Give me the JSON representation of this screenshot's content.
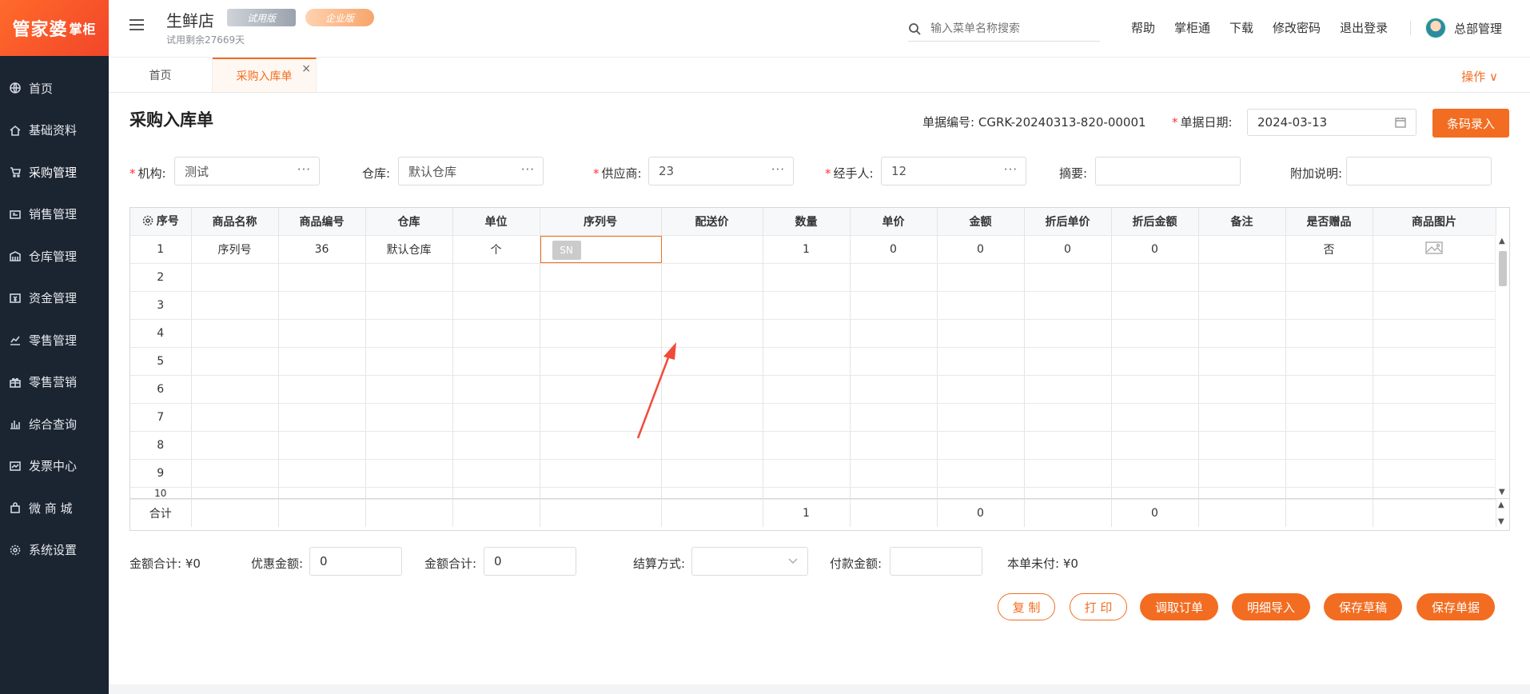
{
  "brand": {
    "logo_text": "管家婆",
    "logo_suffix": "掌柜"
  },
  "sidebar": {
    "items": [
      {
        "label": "首页",
        "icon": "globe-icon"
      },
      {
        "label": "基础资料",
        "icon": "home-icon"
      },
      {
        "label": "采购管理",
        "icon": "cart-icon"
      },
      {
        "label": "销售管理",
        "icon": "sales-icon"
      },
      {
        "label": "仓库管理",
        "icon": "warehouse-icon"
      },
      {
        "label": "资金管理",
        "icon": "money-icon"
      },
      {
        "label": "零售管理",
        "icon": "chart-icon"
      },
      {
        "label": "零售营销",
        "icon": "gift-icon"
      },
      {
        "label": "综合查询",
        "icon": "bar-chart-icon"
      },
      {
        "label": "发票中心",
        "icon": "invoice-icon"
      },
      {
        "label": "微 商 城",
        "icon": "bag-icon"
      },
      {
        "label": "系统设置",
        "icon": "gear-icon"
      }
    ]
  },
  "header": {
    "shop": "生鲜店",
    "trial_badge": "试用版",
    "enterprise_badge": "企业版",
    "trial_days": "试用剩余27669天",
    "search_placeholder": "输入菜单名称搜索",
    "links": [
      "帮助",
      "掌柜通",
      "下载",
      "修改密码",
      "退出登录"
    ],
    "user": "总部管理"
  },
  "tabs": {
    "home": "首页",
    "purchase": "采购入库单",
    "ops": "操作 ∨",
    "close": "×"
  },
  "form": {
    "title": "采购入库单",
    "doc_no_label": "单据编号:",
    "doc_no": "CGRK-20240313-820-00001",
    "date_label": "单据日期:",
    "date": "2024-03-13",
    "barcode_btn": "条码录入",
    "org_label": "机构:",
    "org": "测试",
    "warehouse_label": "仓库:",
    "warehouse": "默认仓库",
    "supplier_label": "供应商:",
    "supplier": "23",
    "handler_label": "经手人:",
    "handler": "12",
    "summary_label": "摘要:",
    "summary": "",
    "extra_label": "附加说明:",
    "extra": "",
    "dots": "···",
    "required_mark": "*"
  },
  "table": {
    "columns": [
      "序号",
      "商品名称",
      "商品编号",
      "仓库",
      "单位",
      "序列号",
      "配送价",
      "数量",
      "单价",
      "金额",
      "折后单价",
      "折后金额",
      "备注",
      "是否赠品",
      "商品图片"
    ],
    "rows": [
      {
        "no": "1",
        "name": "序列号",
        "code": "36",
        "warehouse": "默认仓库",
        "unit": "个",
        "serial": "SN",
        "dist_price": "",
        "qty": "1",
        "price": "0",
        "amount": "0",
        "disc_price": "0",
        "disc_amount": "0",
        "remark": "",
        "gift": "否"
      },
      {
        "no": "2"
      },
      {
        "no": "3"
      },
      {
        "no": "4"
      },
      {
        "no": "5"
      },
      {
        "no": "6"
      },
      {
        "no": "7"
      },
      {
        "no": "8"
      },
      {
        "no": "9"
      },
      {
        "no": "10"
      }
    ],
    "total_label": "合计",
    "total_qty": "1",
    "total_amount": "0",
    "total_disc_amount": "0"
  },
  "bottom": {
    "amount_total_label": "金额合计:",
    "amount_total": "¥0",
    "discount_label": "优惠金额:",
    "discount": "0",
    "amount_total2_label": "金额合计:",
    "amount_total2": "0",
    "settle_label": "结算方式:",
    "settle": "",
    "pay_label": "付款金额:",
    "pay": "",
    "unpaid_label": "本单未付:",
    "unpaid": "¥0"
  },
  "actions": {
    "copy": "复 制",
    "print": "打 印",
    "fetch_order": "调取订单",
    "import_detail": "明细导入",
    "save_draft": "保存草稿",
    "save": "保存单据"
  },
  "colors": {
    "accent": "#f26d21",
    "sidebar": "#1b2431"
  }
}
